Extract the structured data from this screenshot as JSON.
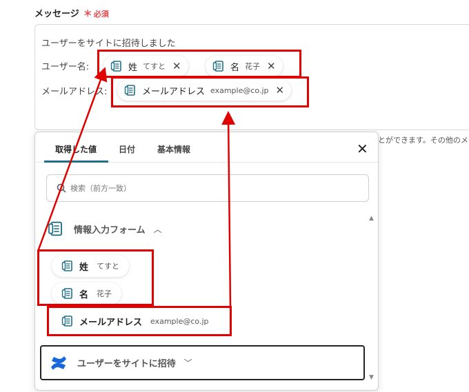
{
  "field": {
    "label": "メッセージ",
    "required_mark": "＊",
    "required_text": "必須"
  },
  "message": {
    "line1": "ユーザーをサイトに招待しました",
    "line2_label": "ユーザー名:",
    "line3_label": "メールアドレス:"
  },
  "chips": {
    "sei": {
      "name": "姓",
      "value": "てすと"
    },
    "mei": {
      "name": "名",
      "value": "花子"
    },
    "email": {
      "name": "メールアドレス",
      "value": "example@co.jp"
    },
    "remove_glyph": "✕"
  },
  "helper_text": "とができます。その他のメ",
  "panel": {
    "tabs": [
      "取得した値",
      "日付",
      "基本情報"
    ],
    "active_tab": 0,
    "close_glyph": "✕",
    "search_placeholder": "検索（前方一致）",
    "section_title": "情報入力フォーム",
    "section_chevron": "︿",
    "items": [
      {
        "name": "姓",
        "value": "てすと"
      },
      {
        "name": "名",
        "value": "花子"
      },
      {
        "name": "メールアドレス",
        "value": "example@co.jp"
      }
    ],
    "app_title": "ユーザーをサイトに招待",
    "app_chevron": "﹀"
  },
  "colors": {
    "highlight": "#e00000",
    "tab_underline": "#1f6f86",
    "required": "#e5484d",
    "app_logo": "#1868db"
  },
  "icons": [
    "form-doc-icon",
    "close-icon",
    "search-icon",
    "chevron-up-icon",
    "chevron-down-icon",
    "confluence-logo-icon"
  ]
}
